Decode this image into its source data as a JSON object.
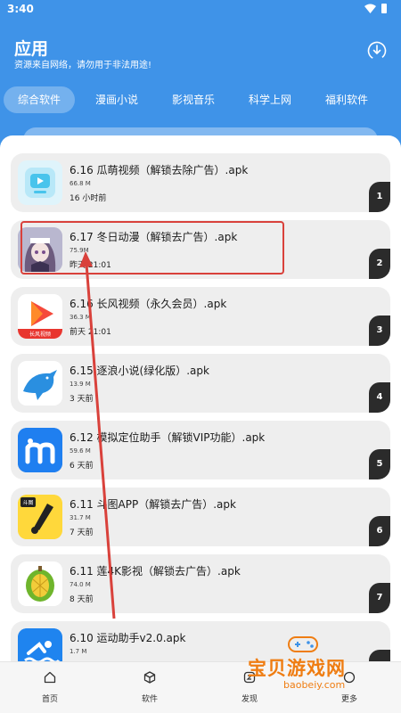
{
  "status": {
    "time": "3:40"
  },
  "header": {
    "title": "应用",
    "subtitle": "资源来自网络，请勿用于非法用途!"
  },
  "tabs": [
    {
      "label": "综合软件",
      "active": true
    },
    {
      "label": "漫画小说",
      "active": false
    },
    {
      "label": "影视音乐",
      "active": false
    },
    {
      "label": "科学上网",
      "active": false
    },
    {
      "label": "福利软件",
      "active": false
    }
  ],
  "apps": [
    {
      "title": "6.16 瓜萌视频（解锁去除广告）.apk",
      "size": "66.8 M",
      "time": "16 小时前",
      "rank": "1",
      "icon": "video-player-icon"
    },
    {
      "title": "6.17 冬日动漫（解锁去广告）.apk",
      "size": "75.9M",
      "time": "昨天 21:01",
      "rank": "2",
      "icon": "anime-girl-icon"
    },
    {
      "title": "6.16 长风视频（永久会员）.apk",
      "size": "36.3 M",
      "time": "前天 21:01",
      "rank": "3",
      "icon": "play-triangle-icon",
      "icon_text": "长风视频"
    },
    {
      "title": "6.15 逐浪小说(绿化版）.apk",
      "size": "13.9 M",
      "time": "3 天前",
      "rank": "4",
      "icon": "dolphin-icon"
    },
    {
      "title": "6.12 模拟定位助手（解锁VIP功能）.apk",
      "size": "59.6 M",
      "time": "6 天前",
      "rank": "5",
      "icon": "location-m-icon"
    },
    {
      "title": "6.11 斗图APP（解锁去广告）.apk",
      "size": "31.7 M",
      "time": "7 天前",
      "rank": "6",
      "icon": "brush-icon",
      "icon_text": "斗图"
    },
    {
      "title": "6.11 莲4K影视（解锁去广告）.apk",
      "size": "74.0 M",
      "time": "8 天前",
      "rank": "7",
      "icon": "durian-icon"
    },
    {
      "title": "6.10 运动助手v2.0.apk",
      "size": "1.7 M",
      "time": "",
      "rank": "",
      "icon": "swimmer-icon"
    }
  ],
  "nav": [
    {
      "label": "首页",
      "icon": "home-icon"
    },
    {
      "label": "软件",
      "icon": "box-icon"
    },
    {
      "label": "发现",
      "icon": "discover-icon"
    },
    {
      "label": "更多",
      "icon": "more-icon"
    }
  ],
  "watermark": {
    "text": "宝贝游戏网",
    "url": "baobeiy.com"
  },
  "colors": {
    "primary": "#3f93e8",
    "highlight": "#d9413b",
    "badge": "#2b2b2b",
    "watermark": "#ef7d12"
  }
}
